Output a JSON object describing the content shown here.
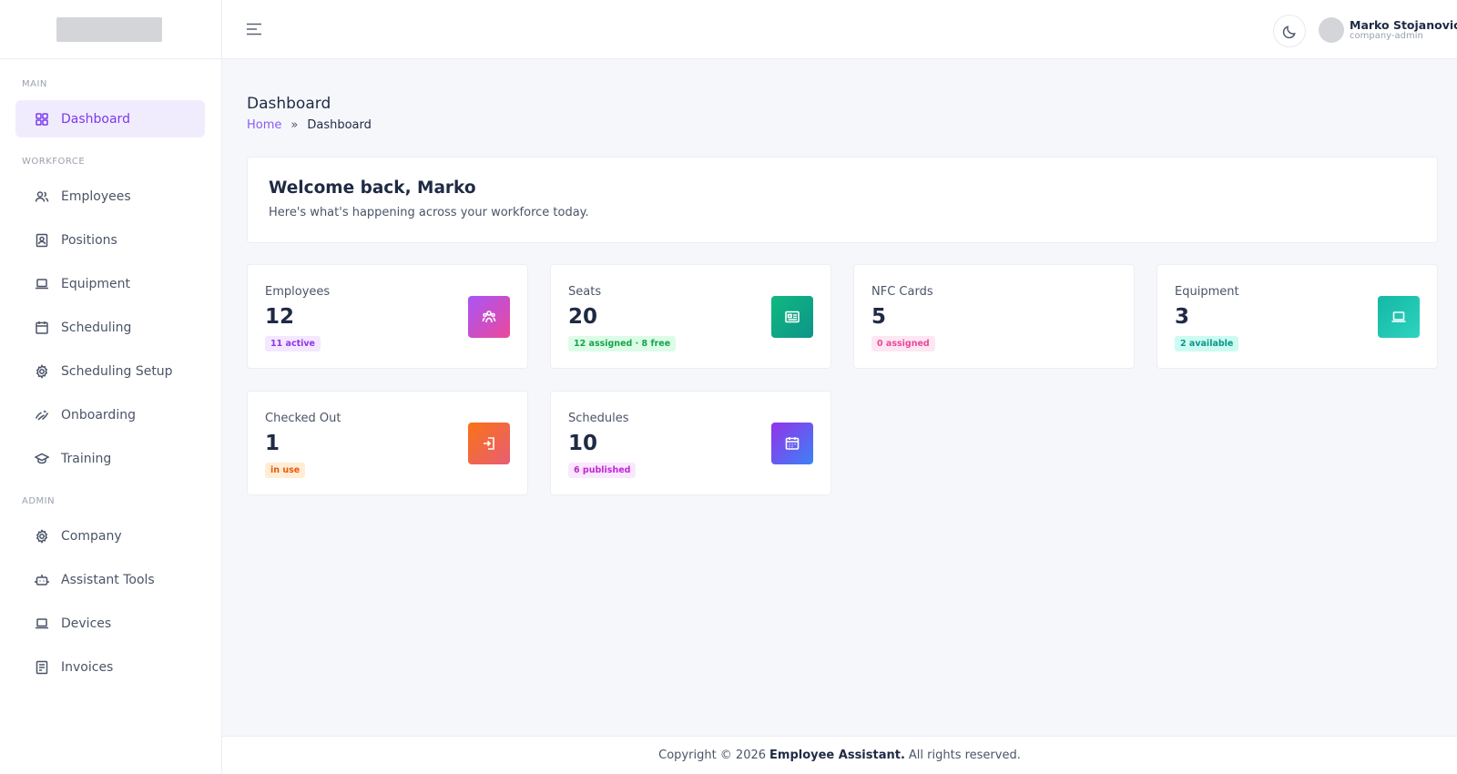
{
  "sidebar": {
    "sections": {
      "main": "MAIN",
      "workforce": "WORKFORCE",
      "admin": "ADMIN"
    },
    "items": {
      "dashboard": {
        "label": "Dashboard",
        "icon": "grid-icon",
        "active": true
      },
      "employees": {
        "label": "Employees",
        "icon": "users-icon"
      },
      "positions": {
        "label": "Positions",
        "icon": "id-badge-icon"
      },
      "equipment": {
        "label": "Equipment",
        "icon": "laptop-icon"
      },
      "scheduling": {
        "label": "Scheduling",
        "icon": "calendar-icon"
      },
      "scheduling_setup": {
        "label": "Scheduling Setup",
        "icon": "gear-icon"
      },
      "onboarding": {
        "label": "Onboarding",
        "icon": "handshake-icon"
      },
      "training": {
        "label": "Training",
        "icon": "graduation-cap-icon"
      },
      "company": {
        "label": "Company",
        "icon": "gear-icon"
      },
      "assistant_tools": {
        "label": "Assistant Tools",
        "icon": "robot-icon"
      },
      "devices": {
        "label": "Devices",
        "icon": "laptop-icon"
      },
      "invoices": {
        "label": "Invoices",
        "icon": "receipt-icon"
      }
    }
  },
  "header": {
    "user_name": "Marko Stojanovic",
    "user_role": "company-admin"
  },
  "page": {
    "title": "Dashboard",
    "breadcrumb_home": "Home",
    "breadcrumb_sep": "»",
    "breadcrumb_current": "Dashboard"
  },
  "welcome": {
    "title": "Welcome back, Marko",
    "subtitle": "Here's what's happening across your workforce today."
  },
  "stats": {
    "employees": {
      "label": "Employees",
      "value": "12",
      "badge": "11 active",
      "icon": "users-icon"
    },
    "seats": {
      "label": "Seats",
      "value": "20",
      "badge": "12 assigned · 8 free",
      "icon": "id-card-icon"
    },
    "nfc": {
      "label": "NFC Cards",
      "value": "5",
      "badge": "0 assigned"
    },
    "equipment": {
      "label": "Equipment",
      "value": "3",
      "badge": "2 available",
      "icon": "laptop-icon"
    },
    "checked_out": {
      "label": "Checked Out",
      "value": "1",
      "badge": "in use",
      "icon": "logout-icon"
    },
    "schedules": {
      "label": "Schedules",
      "value": "10",
      "badge": "6 published",
      "icon": "calendar-icon"
    }
  },
  "footer": {
    "prefix": "Copyright © 2026",
    "brand": "Employee Assistant.",
    "suffix": "All rights reserved."
  },
  "colors": {
    "accent": "#7c3aed",
    "active_bg": "#f1ecfd",
    "employees_gradient": [
      "#a855f7",
      "#ec4899"
    ],
    "seats_gradient": [
      "#10b981",
      "#0d9488"
    ],
    "equipment_gradient": [
      "#14b8a6",
      "#2dd4bf"
    ],
    "checked_out_gradient": [
      "#f97316",
      "#e85d75"
    ],
    "schedules_gradient": [
      "#9333ea",
      "#3b82f6"
    ]
  }
}
